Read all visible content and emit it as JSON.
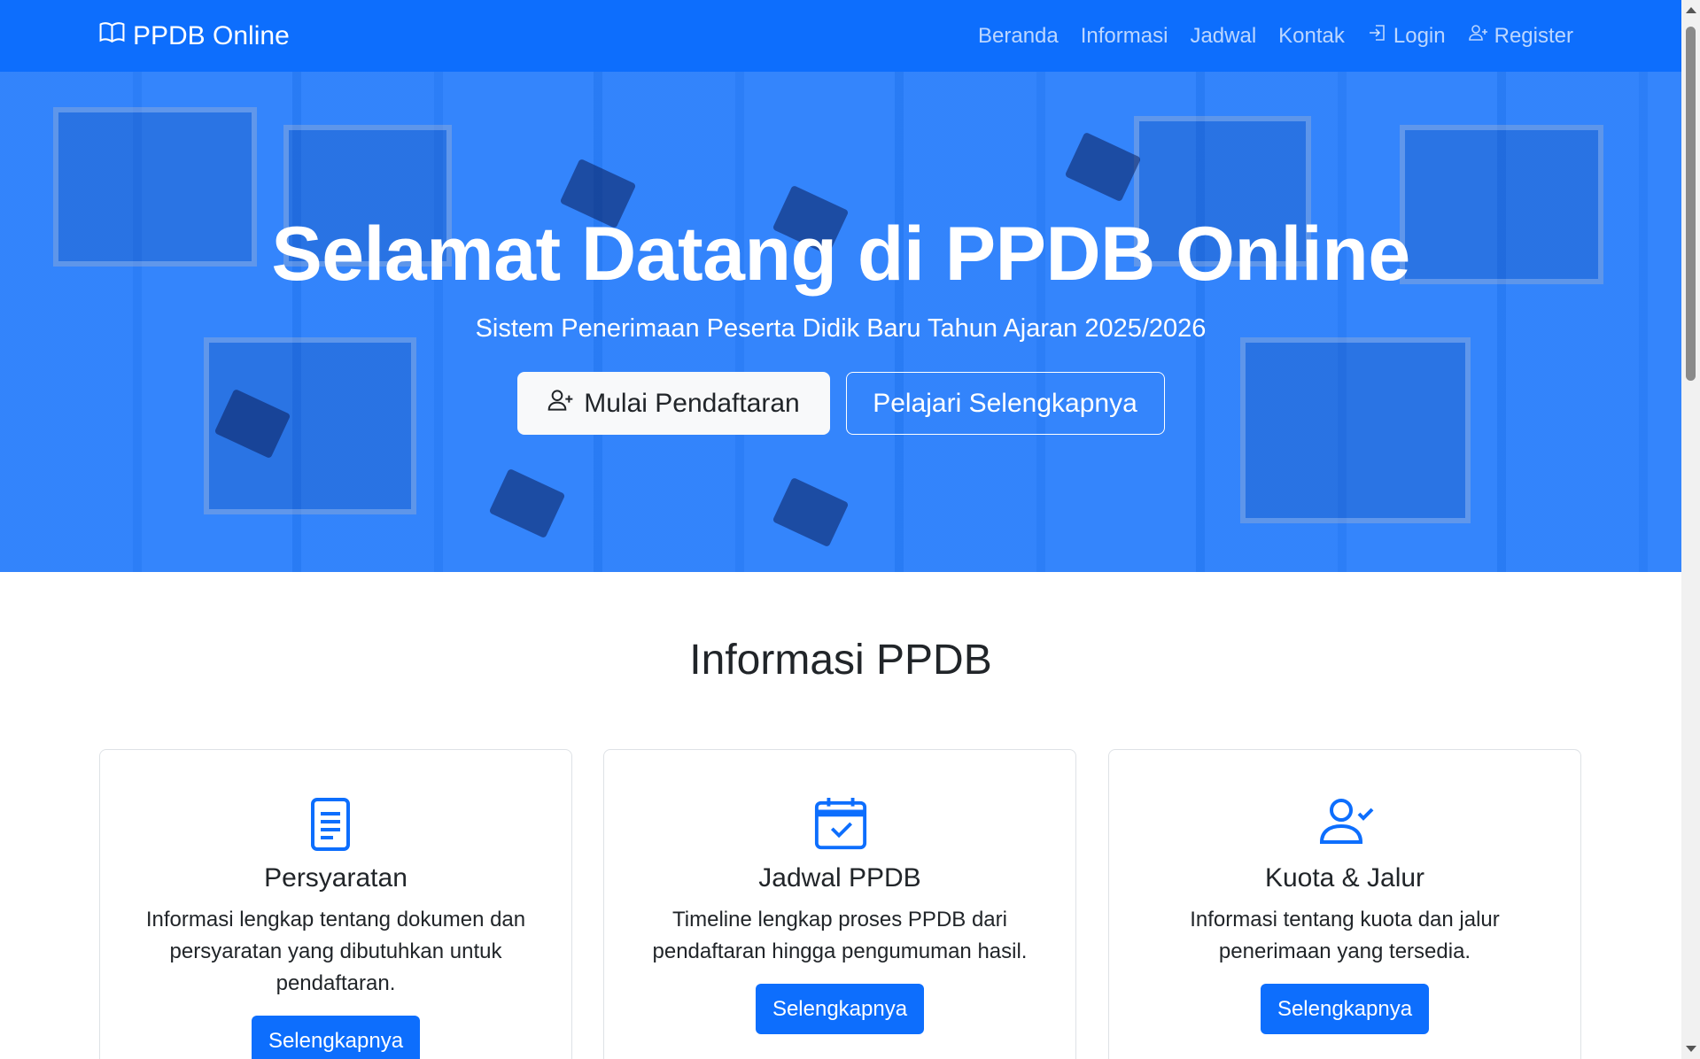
{
  "nav": {
    "brand": "PPDB Online",
    "links": [
      {
        "label": "Beranda"
      },
      {
        "label": "Informasi"
      },
      {
        "label": "Jadwal"
      },
      {
        "label": "Kontak"
      },
      {
        "label": "Login",
        "icon": "login-icon"
      },
      {
        "label": "Register",
        "icon": "register-icon"
      }
    ]
  },
  "hero": {
    "title": "Selamat Datang di PPDB Online",
    "subtitle": "Sistem Penerimaan Peserta Didik Baru Tahun Ajaran 2025/2026",
    "primary_button": "Mulai Pendaftaran",
    "secondary_button": "Pelajari Selengkapnya"
  },
  "info": {
    "title": "Informasi PPDB",
    "cards": [
      {
        "icon": "document-icon",
        "title": "Persyaratan",
        "text": "Informasi lengkap tentang dokumen dan persyaratan yang dibutuhkan untuk pendaftaran.",
        "button": "Selengkapnya"
      },
      {
        "icon": "calendar-check-icon",
        "title": "Jadwal PPDB",
        "text": "Timeline lengkap proses PPDB dari pendaftaran hingga pengumuman hasil.",
        "button": "Selengkapnya"
      },
      {
        "icon": "user-check-icon",
        "title": "Kuota & Jalur",
        "text": "Informasi tentang kuota dan jalur penerimaan yang tersedia.",
        "button": "Selengkapnya"
      }
    ]
  },
  "colors": {
    "primary": "#0d6efd",
    "light": "#f8f9fa",
    "text": "#212529"
  }
}
